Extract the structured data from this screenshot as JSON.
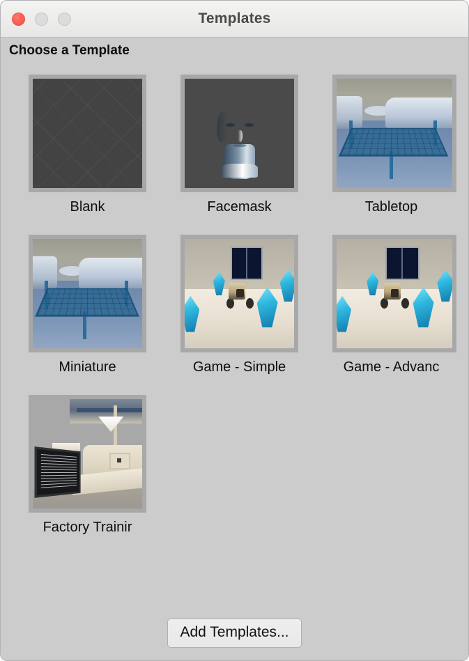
{
  "window": {
    "title": "Templates",
    "controls": {
      "close": "close-button",
      "minimize": "minimize-button",
      "maximize": "maximize-button"
    }
  },
  "content": {
    "section_header": "Choose a Template",
    "templates": [
      {
        "label": "Blank",
        "art": "blank"
      },
      {
        "label": "Facemask",
        "art": "face"
      },
      {
        "label": "Tabletop",
        "art": "room"
      },
      {
        "label": "Miniature",
        "art": "room"
      },
      {
        "label": "Game - Simple",
        "art": "game"
      },
      {
        "label": "Game - Advanc",
        "art": "game"
      },
      {
        "label": "Factory Trainir",
        "art": "factory"
      }
    ]
  },
  "footer": {
    "add_templates_label": "Add Templates..."
  },
  "colors": {
    "window_body": "#cccccc",
    "titlebar": "#ececea",
    "title_text": "#4a4a4a",
    "thumb_frame": "#a8a8a8",
    "close_red": "#fc5b4f",
    "inactive_gray": "#dcdcdc",
    "label_text": "#0d0d0d",
    "button_face": "#eeeeee"
  }
}
